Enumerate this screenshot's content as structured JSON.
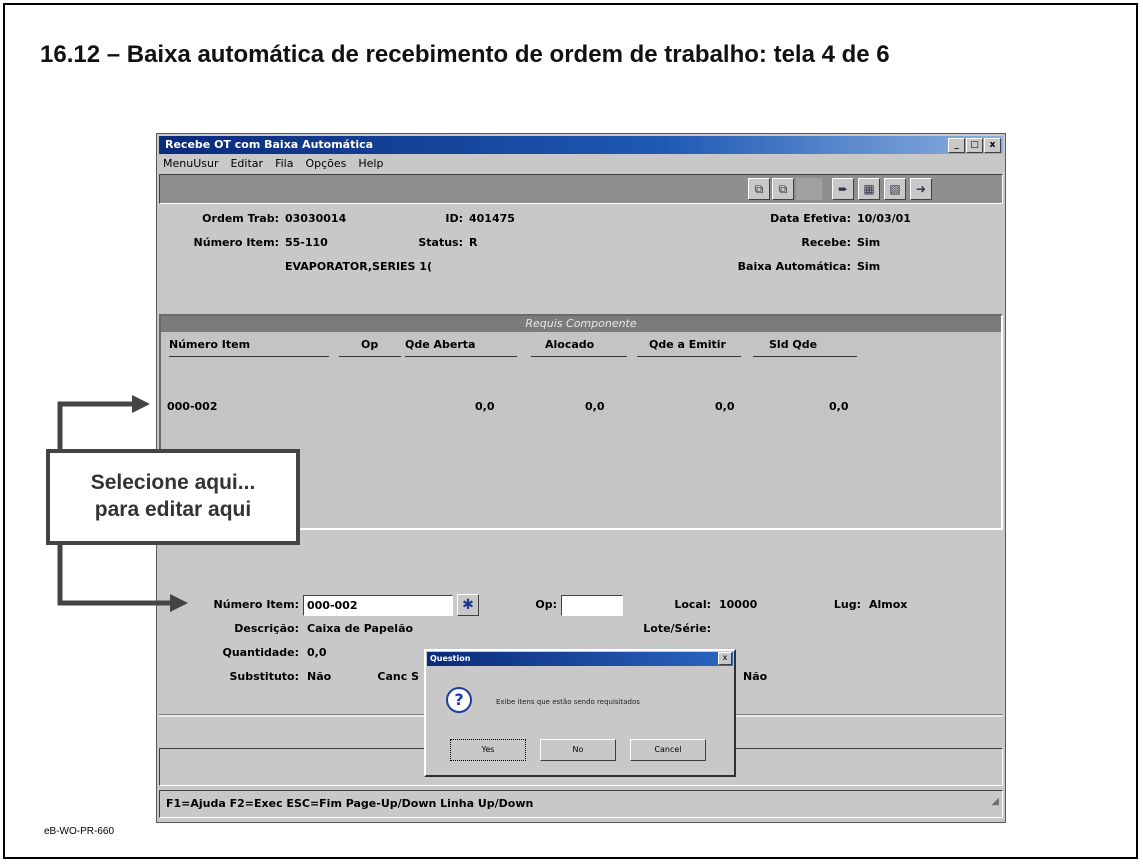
{
  "slide": {
    "title": "16.12 – Baixa automática de recebimento de ordem de trabalho: tela 4 de 6",
    "footer_code": "eB-WO-PR-660"
  },
  "callout": {
    "line1": "Selecione aqui...",
    "line2": "para editar aqui"
  },
  "window": {
    "title": "Recebe OT com Baixa Automática",
    "controls": [
      "_",
      "□",
      "x"
    ],
    "menu": [
      "MenuUsur",
      "Editar",
      "Fila",
      "Opções",
      "Help"
    ]
  },
  "toolbar": {
    "icons": [
      "copy-icon",
      "paste-icon",
      "blank",
      "forward-icon",
      "export-icon",
      "import-icon",
      "exit-icon"
    ]
  },
  "header": {
    "ordem_label": "Ordem Trab:",
    "ordem_value": "03030014",
    "id_label": "ID:",
    "id_value": "401475",
    "data_label": "Data Efetiva:",
    "data_value": "10/03/01",
    "numero_label": "Número Item:",
    "numero_value": "55-110",
    "status_label": "Status:",
    "status_value": "R",
    "recebe_label": "Recebe:",
    "recebe_value": "Sim",
    "descricao_value": "EVAPORATOR,SERIES 1(",
    "baixa_label": "Baixa Automática:",
    "baixa_value": "Sim"
  },
  "grid": {
    "caption": "Requis Componente",
    "columns": [
      "Número Item",
      "Op",
      "Qde Aberta",
      "Alocado",
      "Qde a Emitir",
      "Sld Qde"
    ],
    "rows": [
      {
        "numero_item": "000-002",
        "op": "",
        "qde_aberta": "0,0",
        "alocado": "0,0",
        "qde_emitir": "0,0",
        "sld_qde": "0,0"
      }
    ]
  },
  "detail": {
    "numero_label": "Número Item:",
    "numero_value": "000-002",
    "op_label": "Op:",
    "op_value": "",
    "local_label": "Local:",
    "local_value": "10000",
    "lug_label": "Lug:",
    "lug_value": "Almox",
    "descricao_label": "Descrição:",
    "descricao_value": "Caixa de Papelão",
    "lote_label": "Lote/Série:",
    "quantidade_label": "Quantidade:",
    "quantidade_value": "0,0",
    "substituto_label": "Substituto:",
    "substituto_value": "Não",
    "canc_label": "Canc S",
    "nao_right": "Não"
  },
  "dialog": {
    "title": "Question",
    "close": "x",
    "message": "Exibe itens que estão sendo requisitados",
    "yes": "Yes",
    "no": "No",
    "cancel": "Cancel"
  },
  "statusbar": {
    "text": "F1=Ajuda F2=Exec ESC=Fim Page-Up/Down Linha Up/Down"
  }
}
